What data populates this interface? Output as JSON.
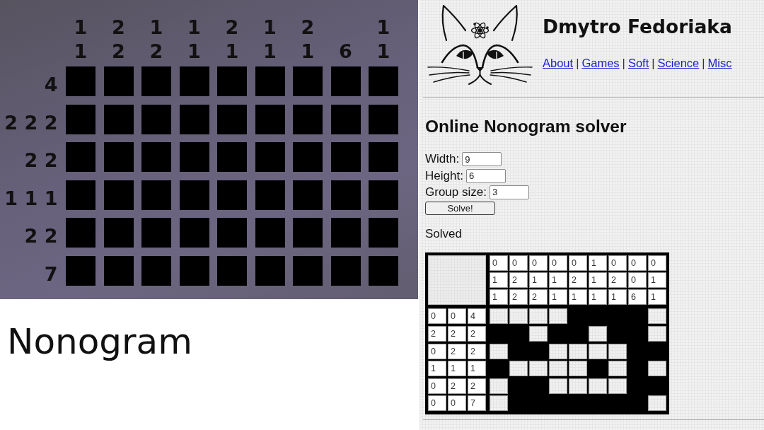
{
  "puzzle": {
    "column_clues": [
      [
        "1",
        "1"
      ],
      [
        "2",
        "2"
      ],
      [
        "1",
        "2"
      ],
      [
        "1",
        "1"
      ],
      [
        "2",
        "1"
      ],
      [
        "1",
        "1"
      ],
      [
        "2",
        "1"
      ],
      [
        "6"
      ],
      [
        "1",
        "1"
      ]
    ],
    "row_clues": [
      "4",
      "2 2 2",
      "2 2",
      "1 1 1",
      "2 2",
      "7"
    ]
  },
  "caption": "Nonogram",
  "site": {
    "title": "Dmytro Fedoriaka",
    "nav": [
      "About",
      "Games",
      "Soft",
      "Science",
      "Misc"
    ],
    "nav_separators": [
      "|",
      "|",
      "|",
      "|"
    ]
  },
  "solver": {
    "heading": "Online Nonogram solver",
    "fields": [
      {
        "label": "Width:",
        "value": "9"
      },
      {
        "label": "Height:",
        "value": "6"
      },
      {
        "label": "Group size:",
        "value": "3"
      }
    ],
    "button": "Solve!",
    "status": "Solved",
    "table": {
      "column_clues": [
        [
          "0",
          "0",
          "0",
          "0",
          "0",
          "1",
          "0",
          "0",
          "0"
        ],
        [
          "1",
          "2",
          "1",
          "1",
          "2",
          "1",
          "2",
          "0",
          "1"
        ],
        [
          "1",
          "2",
          "2",
          "1",
          "1",
          "1",
          "1",
          "6",
          "1"
        ]
      ],
      "row_clues": [
        [
          "0",
          "0",
          "4"
        ],
        [
          "2",
          "2",
          "2"
        ],
        [
          "0",
          "2",
          "2"
        ],
        [
          "1",
          "1",
          "1"
        ],
        [
          "0",
          "2",
          "2"
        ],
        [
          "0",
          "0",
          "7"
        ]
      ],
      "grid": [
        [
          false,
          false,
          false,
          false,
          true,
          true,
          true,
          true,
          false
        ],
        [
          true,
          true,
          false,
          true,
          true,
          false,
          true,
          true,
          false
        ],
        [
          false,
          true,
          true,
          false,
          false,
          false,
          false,
          true,
          true
        ],
        [
          true,
          false,
          false,
          false,
          false,
          true,
          false,
          true,
          false
        ],
        [
          false,
          true,
          true,
          false,
          false,
          false,
          false,
          true,
          true
        ],
        [
          false,
          true,
          true,
          true,
          true,
          true,
          true,
          true,
          false
        ]
      ]
    }
  }
}
